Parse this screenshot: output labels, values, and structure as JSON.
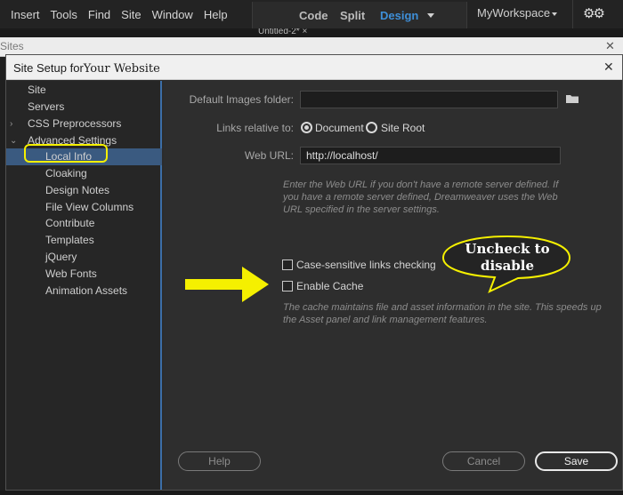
{
  "menu": [
    "Insert",
    "Tools",
    "Find",
    "Site",
    "Window",
    "Help"
  ],
  "views": {
    "code": "Code",
    "split": "Split",
    "design": "Design"
  },
  "workspace": "MyWorkspace",
  "background": {
    "doc_tab": "Untitled-2*  ×",
    "sites_title": "Sites"
  },
  "dialog": {
    "title_prefix": "Site Setup for",
    "title_site": "Your Website",
    "nav": [
      {
        "label": "Site"
      },
      {
        "label": "Servers"
      },
      {
        "label": "CSS Preprocessors"
      },
      {
        "label": "Advanced Settings"
      },
      {
        "label": "Local Info"
      },
      {
        "label": "Cloaking"
      },
      {
        "label": "Design Notes"
      },
      {
        "label": "File View Columns"
      },
      {
        "label": "Contribute"
      },
      {
        "label": "Templates"
      },
      {
        "label": "jQuery"
      },
      {
        "label": "Web Fonts"
      },
      {
        "label": "Animation Assets"
      }
    ],
    "default_images_label": "Default Images folder:",
    "default_images_value": "",
    "links_relative_label": "Links relative to:",
    "radio_document": "Document",
    "radio_site_root": "Site Root",
    "links_selected": "Document",
    "web_url_label": "Web URL:",
    "web_url_value": "http://localhost/",
    "web_url_hint": [
      "Enter the Web URL if you don't have a remote server defined. If",
      "you have a remote server defined, Dreamweaver uses the Web",
      "URL specified in the server settings."
    ],
    "case_sensitive_label": "Case-sensitive links checking",
    "case_sensitive_checked": false,
    "enable_cache_label": "Enable Cache",
    "enable_cache_checked": false,
    "cache_hint": [
      "The cache maintains file and asset information in the site. This speeds up",
      "the Asset panel and link management features."
    ],
    "help_button": "Help",
    "cancel_button": "Cancel",
    "save_button": "Save"
  },
  "annotation": {
    "bubble_line1": "Uncheck to",
    "bubble_line2": "disable",
    "highlight_color": "#f5f000"
  },
  "colors": {
    "accent": "#3e8fd8",
    "selected_nav": "#3a5a80",
    "annotation": "#f5f000"
  }
}
